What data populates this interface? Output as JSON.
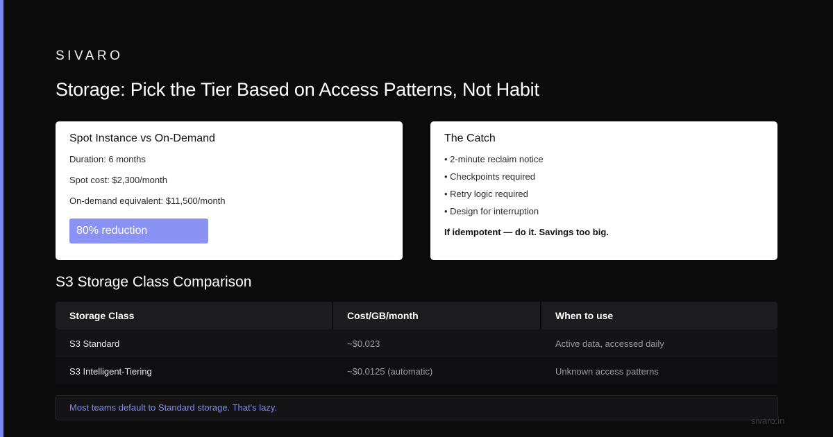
{
  "brand": "SIVARO",
  "title": "Storage: Pick the Tier Based on Access Patterns, Not Habit",
  "spot_card": {
    "title": "Spot Instance vs On-Demand",
    "lines": [
      "Duration: 6 months",
      "Spot cost: $2,300/month",
      "On-demand equivalent: $11,500/month"
    ],
    "badge": "80% reduction"
  },
  "catch_card": {
    "title": "The Catch",
    "bullets": [
      "• 2-minute reclaim notice",
      "• Checkpoints required",
      "• Retry logic required",
      "• Design for interruption"
    ],
    "conclusion": "If idempotent — do it. Savings too big."
  },
  "comparison": {
    "title": "S3 Storage Class Comparison",
    "headers": [
      "Storage Class",
      "Cost/GB/month",
      "When to use"
    ],
    "rows": [
      [
        "S3 Standard",
        "~$0.023",
        "Active data, accessed daily"
      ],
      [
        "S3 Intelligent-Tiering",
        "~$0.0125 (automatic)",
        "Unknown access patterns"
      ]
    ]
  },
  "note": "Most teams default to Standard storage. That's lazy.",
  "footer": "sivaro.in",
  "colors": {
    "accent": "#7b86f0",
    "badge": "#8a93f4",
    "background": "#0b0b0c"
  }
}
